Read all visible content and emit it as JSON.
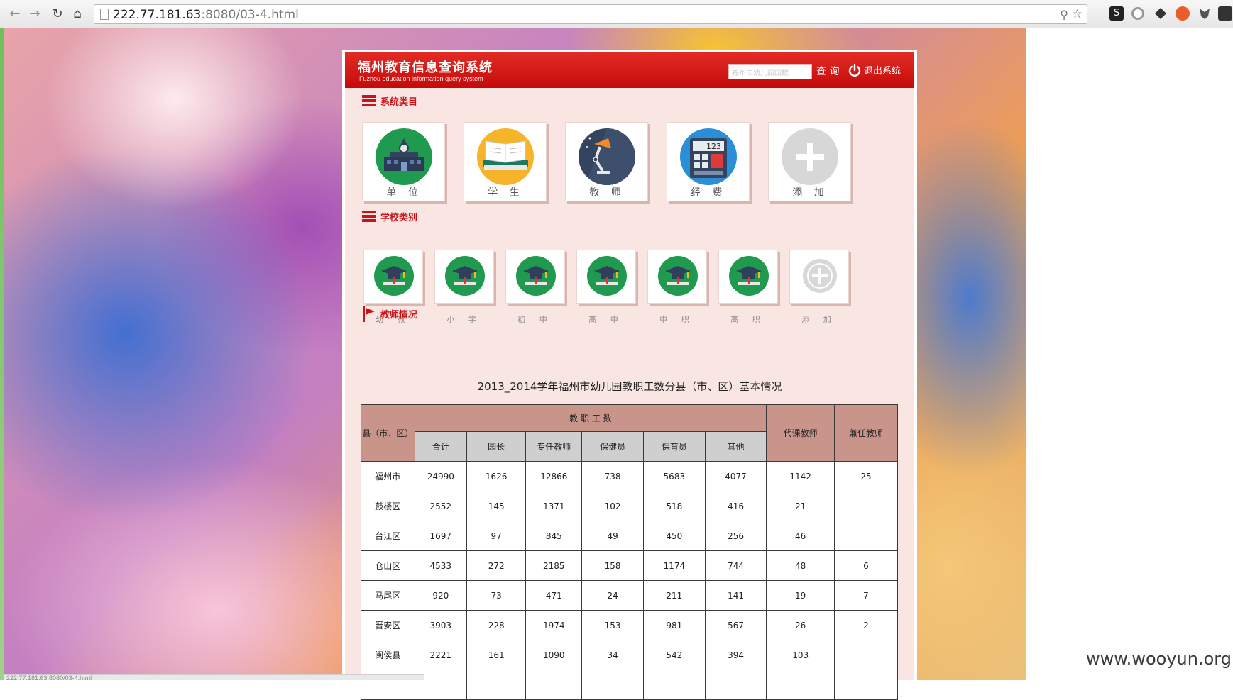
{
  "browser": {
    "url_host": "222.77.181.63",
    "url_rest": ":8080/03-4.html",
    "back_glyph": "←",
    "forward_glyph": "→",
    "reload_glyph": "↻",
    "home_glyph": "⌂",
    "zoom_glyph": "⚲",
    "star_glyph": "☆"
  },
  "header": {
    "title": "福州教育信息查询系统",
    "subtitle": "Fuzhou education information query system",
    "search_placeholder": "福州市幼儿园园数",
    "query_button": "查 询",
    "logout": "退出系统"
  },
  "sections": {
    "system_category": "系统类目",
    "school_category": "学校类别",
    "teacher_status": "教师情况"
  },
  "system_tiles": [
    {
      "label": "单 位",
      "icon": "school-building-icon"
    },
    {
      "label": "学 生",
      "icon": "book-icon"
    },
    {
      "label": "教 师",
      "icon": "desk-lamp-icon"
    },
    {
      "label": "经 费",
      "icon": "calculator-icon"
    },
    {
      "label": "添 加",
      "icon": "add-icon"
    }
  ],
  "calculator_display": "123",
  "school_tiles": [
    {
      "label": "幼 教",
      "icon": "graduation-cap-icon"
    },
    {
      "label": "小 学",
      "icon": "graduation-cap-icon"
    },
    {
      "label": "初 中",
      "icon": "graduation-cap-icon"
    },
    {
      "label": "高 中",
      "icon": "graduation-cap-icon"
    },
    {
      "label": "中 职",
      "icon": "graduation-cap-icon"
    },
    {
      "label": "高 职",
      "icon": "graduation-cap-icon"
    },
    {
      "label": "添 加",
      "icon": "add-icon"
    }
  ],
  "table": {
    "title": "2013_2014学年福州市幼儿园教职工数分县（市、区）基本情况",
    "header_county": "县（市、区）",
    "header_staff": "教 职 工 数",
    "header_substitute": "代课教师",
    "header_parttime": "兼任教师",
    "sub_headers": [
      "合计",
      "园长",
      "专任教师",
      "保健员",
      "保育员",
      "其他"
    ],
    "rows": [
      [
        "福州市",
        "24990",
        "1626",
        "12866",
        "738",
        "5683",
        "4077",
        "1142",
        "25"
      ],
      [
        "鼓楼区",
        "2552",
        "145",
        "1371",
        "102",
        "518",
        "416",
        "21",
        ""
      ],
      [
        "台江区",
        "1697",
        "97",
        "845",
        "49",
        "450",
        "256",
        "46",
        ""
      ],
      [
        "仓山区",
        "4533",
        "272",
        "2185",
        "158",
        "1174",
        "744",
        "48",
        "6"
      ],
      [
        "马尾区",
        "920",
        "73",
        "471",
        "24",
        "211",
        "141",
        "19",
        "7"
      ],
      [
        "晋安区",
        "3903",
        "228",
        "1974",
        "153",
        "981",
        "567",
        "26",
        "2"
      ],
      [
        "闽侯县",
        "2221",
        "161",
        "1090",
        "34",
        "542",
        "394",
        "103",
        ""
      ],
      [
        "",
        "",
        "",
        "",
        "",
        "",
        "",
        "",
        ""
      ]
    ]
  },
  "status_url": "222.77.181.63:8080/03-4.html",
  "watermark": "www.wooyun.org",
  "colors": {
    "header_red": "#d8171a",
    "accent_red": "#c9151a",
    "tile_green": "#1f9a4f",
    "table_header": "#c9948a"
  }
}
